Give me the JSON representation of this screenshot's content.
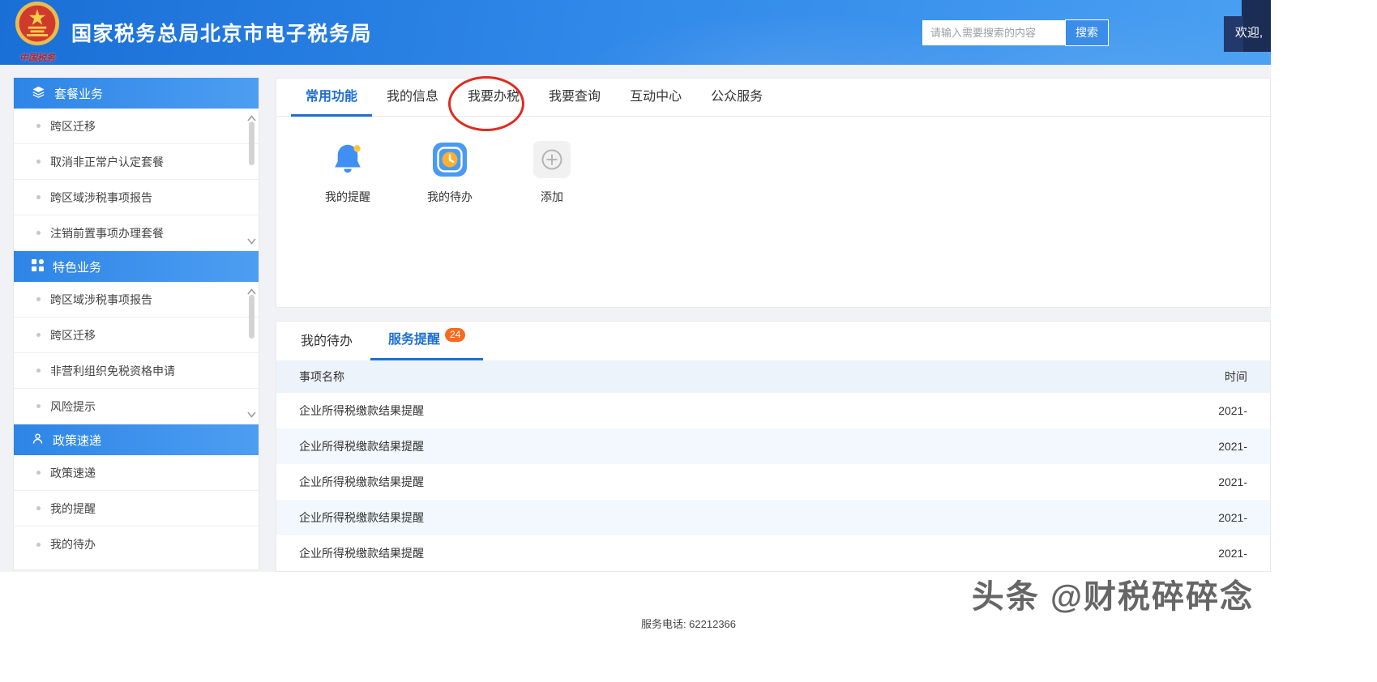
{
  "header": {
    "title": "国家税务总局北京市电子税务局",
    "logo_caption": "中国税务",
    "search": {
      "placeholder": "请输入需要搜索的内容",
      "button": "搜索"
    },
    "welcome": "欢迎,"
  },
  "sidebar": {
    "sections": [
      {
        "title": "套餐业务",
        "icon": "layers-icon",
        "items": [
          "跨区迁移",
          "取消非正常户认定套餐",
          "跨区域涉税事项报告",
          "注销前置事项办理套餐"
        ]
      },
      {
        "title": "特色业务",
        "icon": "apps-grid-icon",
        "items": [
          "跨区域涉税事项报告",
          "跨区迁移",
          "非营利组织免税资格申请",
          "风险提示"
        ]
      },
      {
        "title": "政策速递",
        "icon": "user-icon",
        "items": [
          "政策速递",
          "我的提醒",
          "我的待办"
        ]
      }
    ]
  },
  "main": {
    "tabs": [
      "常用功能",
      "我的信息",
      "我要办税",
      "我要查询",
      "互动中心",
      "公众服务"
    ],
    "active_tab": "常用功能",
    "shortcuts": [
      {
        "label": "我的提醒",
        "icon": "bell-icon"
      },
      {
        "label": "我的待办",
        "icon": "clock-icon"
      },
      {
        "label": "添加",
        "icon": "plus-icon"
      }
    ],
    "panel": {
      "tabs": [
        {
          "label": "我的待办"
        },
        {
          "label": "服务提醒",
          "badge": "24"
        }
      ],
      "active_tab": "服务提醒",
      "columns": {
        "name": "事项名称",
        "time": "时间"
      },
      "rows": [
        {
          "name": "企业所得税缴款结果提醒",
          "time": "2021-"
        },
        {
          "name": "企业所得税缴款结果提醒",
          "time": "2021-"
        },
        {
          "name": "企业所得税缴款结果提醒",
          "time": "2021-"
        },
        {
          "name": "企业所得税缴款结果提醒",
          "time": "2021-"
        },
        {
          "name": "企业所得税缴款结果提醒",
          "time": "2021-"
        }
      ]
    }
  },
  "footer": {
    "phone": "服务电话: 62212366"
  },
  "watermark": "头条 @财税碎碎念",
  "colors": {
    "accent": "#1f6fd0",
    "header_blue": "#2f87e8",
    "badge_orange": "#fa6a1e",
    "annotation_red": "#e02b20"
  }
}
